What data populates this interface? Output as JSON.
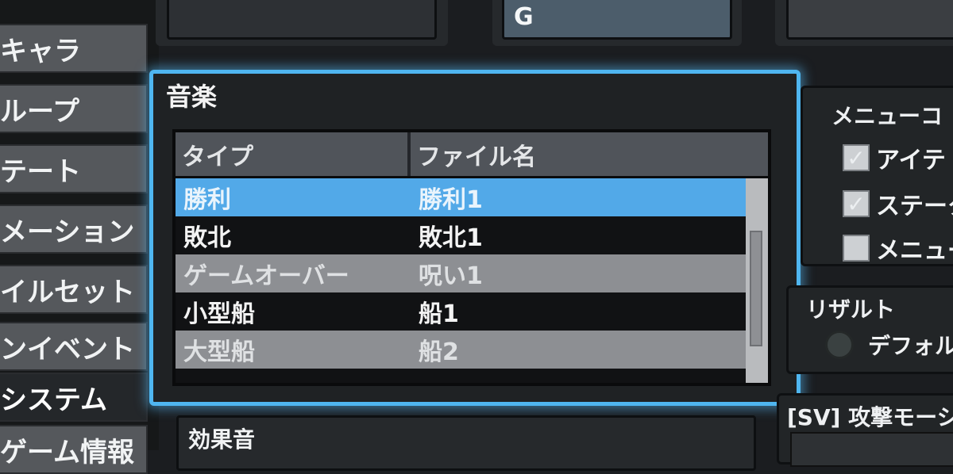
{
  "sidebar": {
    "items": [
      {
        "label": "キャラ"
      },
      {
        "label": "ループ"
      },
      {
        "label": "テート"
      },
      {
        "label": "メーション"
      },
      {
        "label": "イルセット"
      },
      {
        "label": "ンイベント"
      },
      {
        "label": "システム"
      },
      {
        "label": "ゲーム情報"
      }
    ],
    "active_index": 6
  },
  "top_fields": {
    "g_value": "G"
  },
  "music": {
    "title": "音楽",
    "columns": [
      "タイプ",
      "ファイル名"
    ],
    "rows": [
      {
        "type": "勝利",
        "file": "勝利1",
        "state": "selected"
      },
      {
        "type": "敗北",
        "file": "敗北1",
        "state": "normal"
      },
      {
        "type": "ゲームオーバー",
        "file": "呪い1",
        "state": "alt"
      },
      {
        "type": "小型船",
        "file": "船1",
        "state": "normal"
      },
      {
        "type": "大型船",
        "file": "船2",
        "state": "alt"
      }
    ]
  },
  "sound_effects": {
    "title": "効果音"
  },
  "menu_commands": {
    "title": "メニューコ",
    "options": [
      {
        "label": "アイテ",
        "checked": true
      },
      {
        "label": "ステータ",
        "checked": true
      },
      {
        "label": "メニュー",
        "checked": false
      }
    ]
  },
  "result": {
    "title": "リザルト",
    "option_label": "デフォル"
  },
  "sv_motion": {
    "title": "[SV] 攻撃モーショ"
  },
  "colors": {
    "accent_blue": "#4fb6f0",
    "selected_row": "#52a9e8",
    "background": "#1b1d20"
  }
}
